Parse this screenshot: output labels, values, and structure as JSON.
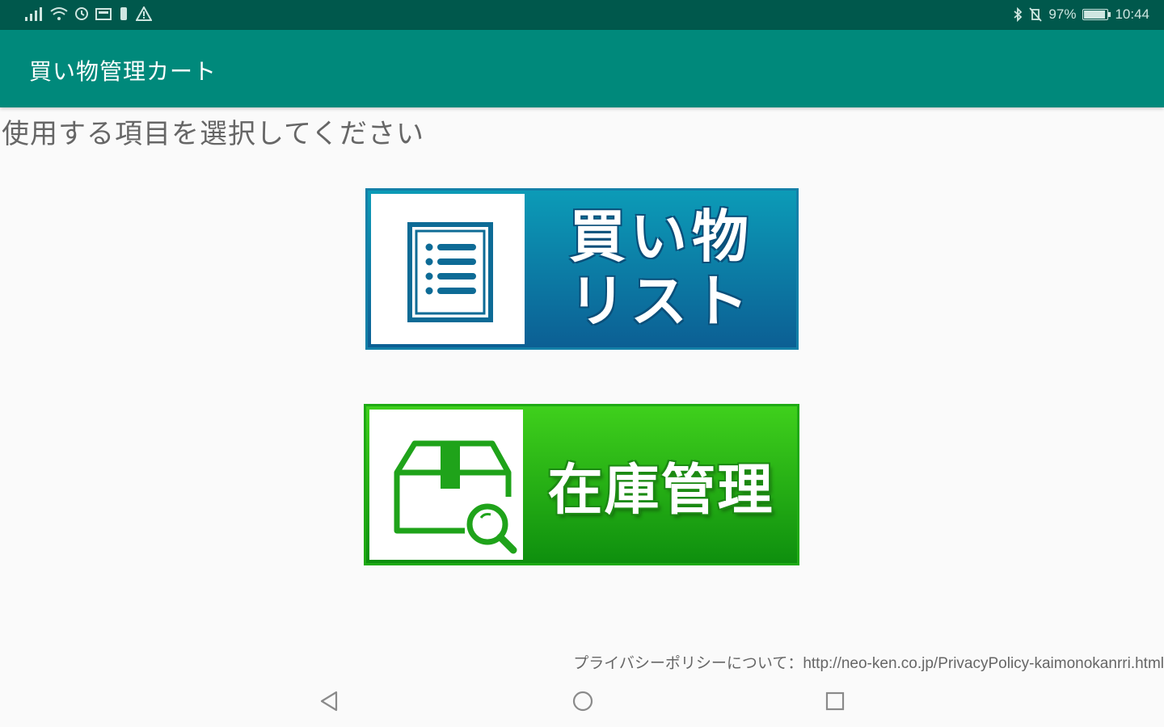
{
  "status_bar": {
    "battery_percent": "97%",
    "time": "10:44"
  },
  "app_bar": {
    "title": "買い物管理カート"
  },
  "prompt": "使用する項目を選択してください",
  "menu": {
    "shopping_list": {
      "line1": "買い物",
      "line2": "リスト",
      "icon": "list-document-icon",
      "color": "#0c7fa6"
    },
    "inventory": {
      "label": "在庫管理",
      "icon": "box-search-icon",
      "color": "#22b514"
    }
  },
  "privacy": {
    "text": "プライバシーポリシーについて：http://neo-ken.co.jp/PrivacyPolicy-kaimonokanrri.html"
  },
  "colors": {
    "status_bar": "#00584c",
    "app_bar": "#00897b",
    "background": "#fafafa"
  }
}
